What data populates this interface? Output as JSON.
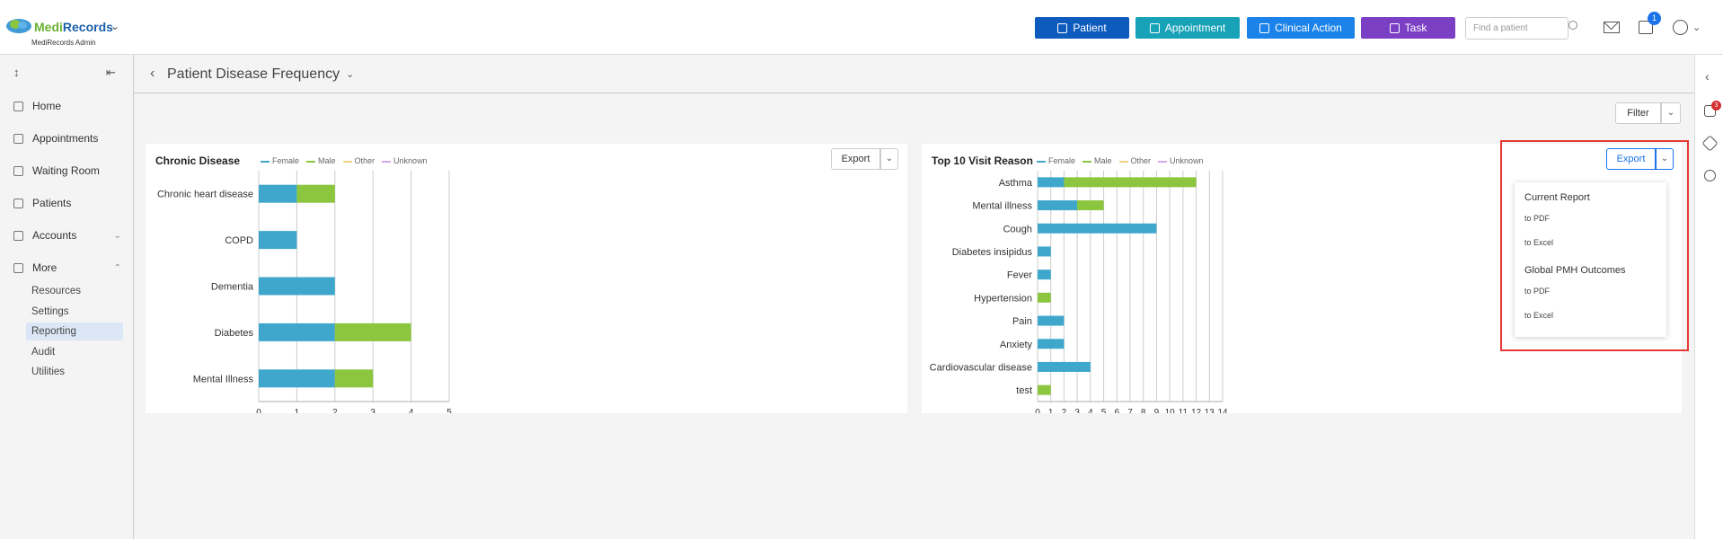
{
  "app": {
    "brand_medi": "Medi",
    "brand_records": "Records",
    "subtitle": "MediRecords Admin"
  },
  "header": {
    "buttons": [
      {
        "label": "Patient",
        "color": "#0d5bbd"
      },
      {
        "label": "Appointment",
        "color": "#17a2b8"
      },
      {
        "label": "Clinical Action",
        "color": "#1a82e8"
      },
      {
        "label": "Task",
        "color": "#7b3fc4"
      }
    ],
    "search_placeholder": "Find a patient",
    "calendar_badge": "1"
  },
  "sidebar": {
    "items": [
      {
        "label": "Home",
        "icon": "home-icon"
      },
      {
        "label": "Appointments",
        "icon": "calendar-icon"
      },
      {
        "label": "Waiting Room",
        "icon": "people-icon"
      },
      {
        "label": "Patients",
        "icon": "patients-icon"
      },
      {
        "label": "Accounts",
        "icon": "folder-icon"
      },
      {
        "label": "More",
        "icon": "folder-icon"
      }
    ],
    "sub_items": [
      "Resources",
      "Settings",
      "Reporting",
      "Audit",
      "Utilities"
    ],
    "active_sub": "Reporting"
  },
  "rail": {
    "notification_badge": "3"
  },
  "page": {
    "title": "Patient Disease Frequency",
    "filter_label": "Filter"
  },
  "legend": [
    {
      "label": "Female",
      "color": "#3fa7cc"
    },
    {
      "label": "Male",
      "color": "#8cc63f"
    },
    {
      "label": "Other",
      "color": "#f5d08a"
    },
    {
      "label": "Unknown",
      "color": "#d8a8e8"
    }
  ],
  "export_menu": {
    "button_label": "Export",
    "sections": [
      {
        "title": "Current Report",
        "items": [
          "to PDF",
          "to Excel"
        ]
      },
      {
        "title": "Global PMH Outcomes",
        "items": [
          "to PDF",
          "to Excel"
        ]
      }
    ]
  },
  "chart_data": [
    {
      "type": "bar",
      "orientation": "horizontal",
      "stacked": true,
      "title": "Chronic Disease",
      "categories": [
        "Chronic heart disease",
        "COPD",
        "Dementia",
        "Diabetes",
        "Mental Illness"
      ],
      "series": [
        {
          "name": "Female",
          "values": [
            1,
            1,
            2,
            2,
            2
          ]
        },
        {
          "name": "Male",
          "values": [
            1,
            0,
            0,
            2,
            1
          ]
        },
        {
          "name": "Other",
          "values": [
            0,
            0,
            0,
            0,
            0
          ]
        },
        {
          "name": "Unknown",
          "values": [
            0,
            0,
            0,
            0,
            0
          ]
        }
      ],
      "xlim": [
        0,
        5
      ],
      "xticks": [
        "0",
        "1",
        "2",
        "3",
        "4",
        "5"
      ],
      "grid": true,
      "legend": "top"
    },
    {
      "type": "bar",
      "orientation": "horizontal",
      "stacked": true,
      "title": "Top 10 Visit Reason",
      "categories": [
        "Asthma",
        "Mental illness",
        "Cough",
        "Diabetes insipidus",
        "Fever",
        "Hypertension",
        "Pain",
        "Anxiety",
        "Cardiovascular disease",
        "test"
      ],
      "series": [
        {
          "name": "Female",
          "values": [
            2,
            3,
            9,
            1,
            1,
            0,
            2,
            2,
            4,
            0
          ]
        },
        {
          "name": "Male",
          "values": [
            10,
            2,
            0,
            0,
            0,
            1,
            0,
            0,
            0,
            1
          ]
        },
        {
          "name": "Other",
          "values": [
            0,
            0,
            0,
            0,
            0,
            0,
            0,
            0,
            0,
            0
          ]
        },
        {
          "name": "Unknown",
          "values": [
            0,
            0,
            0,
            0,
            0,
            0,
            0,
            0,
            0,
            0
          ]
        }
      ],
      "xlim": [
        0,
        14
      ],
      "xticks": [
        "0",
        "1",
        "2",
        "3",
        "4",
        "5",
        "6",
        "7",
        "8",
        "9",
        "10",
        "11",
        "12",
        "13",
        "14"
      ],
      "grid": true,
      "legend": "top"
    }
  ]
}
